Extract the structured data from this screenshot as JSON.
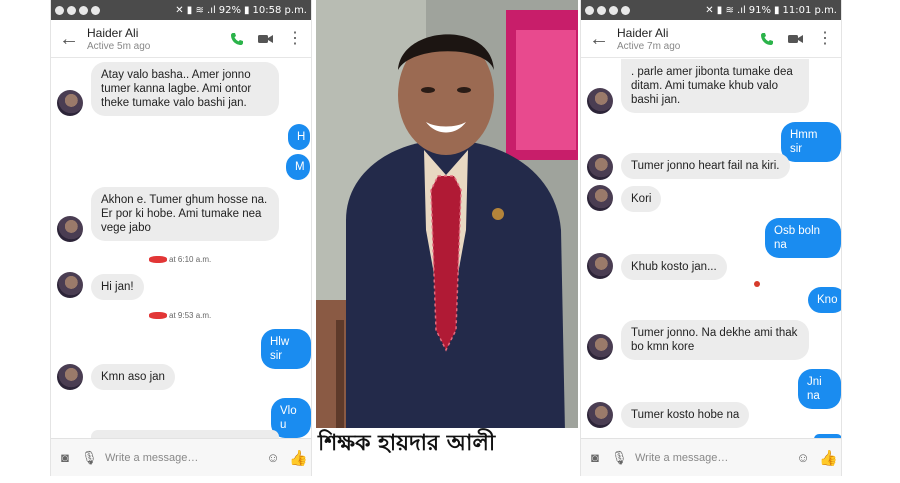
{
  "left_phone": {
    "status": {
      "battery": "92%",
      "time": "10:58 p.m."
    },
    "header": {
      "name": "Haider Ali",
      "active": "Active 5m ago"
    },
    "messages": [
      {
        "side": "in",
        "text": "Atay valo basha.. Amer jonno tumer kanna lagbe. Ami ontor theke tumake valo bashi  jan."
      },
      {
        "side": "out",
        "text": "H"
      },
      {
        "side": "out",
        "text": "M"
      },
      {
        "side": "in",
        "text": "Akhon  e. Tumer  ghum  hosse na. Er por ki hobe. Ami tumake nea vege jabo"
      },
      {
        "side": "ts",
        "text": "at 6:10 a.m."
      },
      {
        "side": "in",
        "text": "Hi jan!"
      },
      {
        "side": "ts",
        "text": "at 9:53 a.m."
      },
      {
        "side": "out",
        "text": "Hlw sir"
      },
      {
        "side": "in",
        "text": "Kmn aso jan"
      },
      {
        "side": "out",
        "text": "Vlo u"
      }
    ],
    "composer_placeholder": "Write a message…"
  },
  "right_phone": {
    "status": {
      "battery": "91%",
      "time": "11:01 p.m."
    },
    "header": {
      "name": "Haider Ali",
      "active": "Active 7m ago"
    },
    "messages": [
      {
        "side": "in",
        "text": ". parle amer jibonta tumake dea ditam. Ami  tumake  khub valo bashi jan."
      },
      {
        "side": "out",
        "text": "Hmm sir"
      },
      {
        "side": "in",
        "text": "Tumer jonno heart fail na kiri."
      },
      {
        "side": "in",
        "text": "Kori"
      },
      {
        "side": "out",
        "text": "Osb boln na"
      },
      {
        "side": "in",
        "text": "Khub kosto jan..."
      },
      {
        "side": "out",
        "text": "Kno"
      },
      {
        "side": "in",
        "text": "Tumer jonno. Na dekhe ami thak bo kmn kore"
      },
      {
        "side": "out",
        "text": "Jni na"
      },
      {
        "side": "in",
        "text": "Tumer  kosto hobe na"
      }
    ],
    "composer_placeholder": "Write a message…"
  },
  "photo": {
    "caption": "শিক্ষক হায়দার আলী"
  },
  "colors": {
    "outgoing_bubble": "#1a8cf0",
    "incoming_bubble": "#ececec",
    "status_bar": "#4b4b4b"
  },
  "icons": [
    "back-arrow-icon",
    "phone-icon",
    "video-icon",
    "more-icon",
    "camera-icon",
    "mic-icon",
    "emoji-icon",
    "like-icon"
  ]
}
